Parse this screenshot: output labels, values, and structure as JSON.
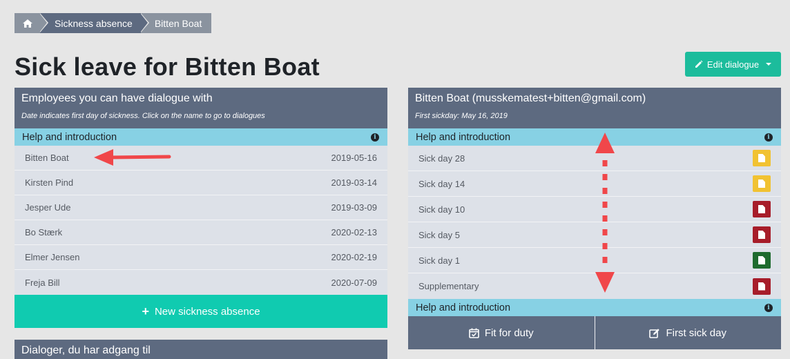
{
  "breadcrumb": {
    "home_icon": "home-icon",
    "items": [
      {
        "label": "Sickness absence"
      },
      {
        "label": "Bitten Boat"
      }
    ]
  },
  "page_title": "Sick leave for Bitten Boat",
  "edit_button": {
    "label": "Edit dialogue",
    "icon": "pencil-icon"
  },
  "employees_panel": {
    "title": "Employees you can have dialogue with",
    "subtitle": "Date indicates first day of sickness. Click on the name to go to dialogues",
    "help_label": "Help and introduction",
    "rows": [
      {
        "name": "Bitten Boat",
        "date": "2019-05-16"
      },
      {
        "name": "Kirsten Pind",
        "date": "2019-03-14"
      },
      {
        "name": "Jesper Ude",
        "date": "2019-03-09"
      },
      {
        "name": "Bo Stærk",
        "date": "2020-02-13"
      },
      {
        "name": "Elmer Jensen",
        "date": "2020-02-19"
      },
      {
        "name": "Freja Bill",
        "date": "2020-07-09"
      }
    ],
    "new_button": "New sickness absence"
  },
  "access_panel": {
    "title": "Dialoger, du har adgang til"
  },
  "detail_panel": {
    "title": "Bitten Boat (musskematest+bitten@gmail.com)",
    "subtitle": "First sickday: May 16, 2019",
    "help_label_top": "Help and introduction",
    "help_label_bottom": "Help and introduction",
    "rows": [
      {
        "label": "Sick day 28",
        "status": "yellow"
      },
      {
        "label": "Sick day 14",
        "status": "yellow"
      },
      {
        "label": "Sick day 10",
        "status": "red"
      },
      {
        "label": "Sick day 5",
        "status": "red"
      },
      {
        "label": "Sick day 1",
        "status": "green"
      },
      {
        "label": "Supplementary",
        "status": "red"
      }
    ],
    "actions": [
      {
        "label": "Fit for duty",
        "icon": "calendar-check-icon"
      },
      {
        "label": "First sick day",
        "icon": "edit-square-icon"
      }
    ]
  },
  "colors": {
    "header": "#5d6a80",
    "help": "#87d1e4",
    "teal": "#10cbb0",
    "annotation_arrow": "#f0474a"
  }
}
